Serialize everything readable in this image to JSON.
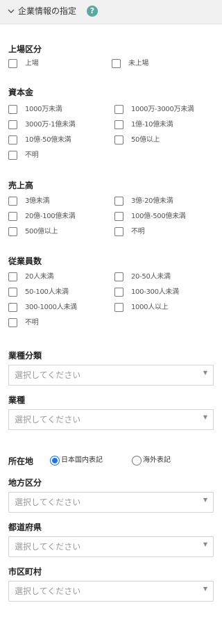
{
  "header": {
    "title": "企業情報の指定",
    "help_icon": "?"
  },
  "listing": {
    "title": "上場区分",
    "options": [
      {
        "label": "上場"
      },
      {
        "label": "未上場"
      }
    ]
  },
  "capital": {
    "title": "資本金",
    "options": [
      {
        "label": "1000万未満"
      },
      {
        "label": "1000万-3000万未満"
      },
      {
        "label": "3000万-1億未満"
      },
      {
        "label": "1億-10億未満"
      },
      {
        "label": "10億-50億未満"
      },
      {
        "label": "50億以上"
      },
      {
        "label": "不明"
      }
    ]
  },
  "sales": {
    "title": "売上高",
    "options": [
      {
        "label": "3億未満"
      },
      {
        "label": "3億-20億未満"
      },
      {
        "label": "20億-100億未満"
      },
      {
        "label": "100億-500億未満"
      },
      {
        "label": "500億以上"
      },
      {
        "label": "不明"
      }
    ]
  },
  "employees": {
    "title": "従業員数",
    "options": [
      {
        "label": "20人未満"
      },
      {
        "label": "20-50人未満"
      },
      {
        "label": "50-100人未満"
      },
      {
        "label": "100-300人未満"
      },
      {
        "label": "300-1000人未満"
      },
      {
        "label": "1000人以上"
      },
      {
        "label": "不明"
      }
    ]
  },
  "industry_category": {
    "title": "業種分類",
    "placeholder": "選択してください"
  },
  "industry": {
    "title": "業種",
    "placeholder": "選択してください"
  },
  "location": {
    "title": "所在地",
    "options": [
      {
        "label": "日本国内表記",
        "selected": true
      },
      {
        "label": "海外表記",
        "selected": false
      }
    ]
  },
  "region": {
    "title": "地方区分",
    "placeholder": "選択してください"
  },
  "prefecture": {
    "title": "都道府県",
    "placeholder": "選択してください"
  },
  "city": {
    "title": "市区町村",
    "placeholder": "選択してください"
  },
  "colors": {
    "accent": "#1a73e8",
    "help": "#5aa9a0",
    "header_bg": "#f0f0f0"
  }
}
